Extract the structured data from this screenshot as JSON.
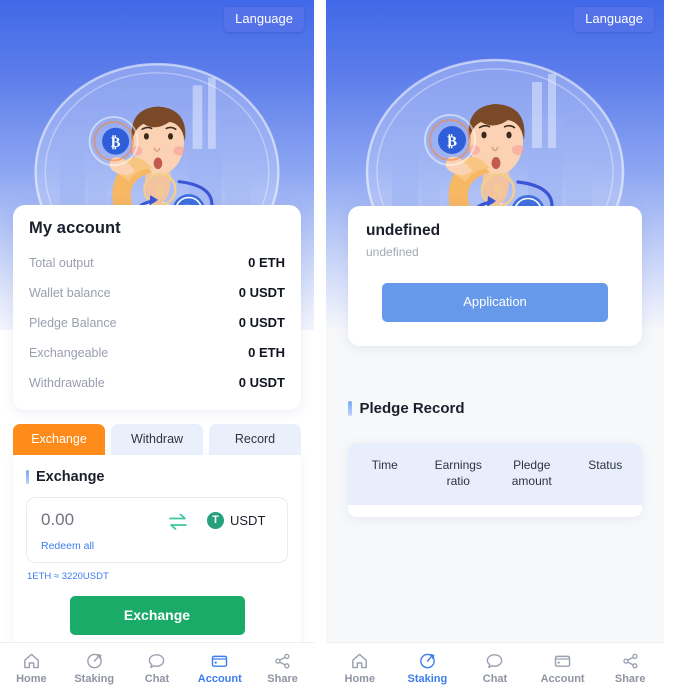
{
  "left": {
    "language_button": "Language",
    "account": {
      "title": "My account",
      "rows": [
        {
          "label": "Total output",
          "value": "0 ETH"
        },
        {
          "label": "Wallet balance",
          "value": "0 USDT"
        },
        {
          "label": "Pledge Balance",
          "value": "0 USDT"
        },
        {
          "label": "Exchangeable",
          "value": "0 ETH"
        },
        {
          "label": "Withdrawable",
          "value": "0 USDT"
        }
      ]
    },
    "tabs": [
      {
        "label": "Exchange",
        "active": true
      },
      {
        "label": "Withdraw",
        "active": false
      },
      {
        "label": "Record",
        "active": false
      }
    ],
    "exchange": {
      "section_title": "Exchange",
      "amount": "0.00",
      "amount_placeholder": "0.00",
      "redeem_all": "Redeem all",
      "swap_icon": "swap-arrows-icon",
      "coin_symbol": "T",
      "coin_label": "USDT",
      "rate": "1ETH ≈ 3220USDT",
      "submit_label": "Exchange"
    },
    "nav": [
      {
        "label": "Home",
        "icon": "home-icon",
        "active": false
      },
      {
        "label": "Staking",
        "icon": "staking-icon",
        "active": false
      },
      {
        "label": "Chat",
        "icon": "chat-icon",
        "active": false
      },
      {
        "label": "Account",
        "icon": "wallet-icon",
        "active": true
      },
      {
        "label": "Share",
        "icon": "share-icon",
        "active": false
      }
    ]
  },
  "right": {
    "language_button": "Language",
    "info_card": {
      "title": "undefined",
      "subtitle": "undefined",
      "button_label": "Application"
    },
    "pledge_record": {
      "title": "Pledge Record",
      "columns": [
        "Time",
        "Earnings ratio",
        "Pledge amount",
        "Status"
      ],
      "rows": []
    },
    "nav": [
      {
        "label": "Home",
        "icon": "home-icon",
        "active": false
      },
      {
        "label": "Staking",
        "icon": "staking-icon",
        "active": true
      },
      {
        "label": "Chat",
        "icon": "chat-icon",
        "active": false
      },
      {
        "label": "Account",
        "icon": "wallet-icon",
        "active": false
      },
      {
        "label": "Share",
        "icon": "share-icon",
        "active": false
      }
    ]
  },
  "colors": {
    "hero_top": "#4169e8",
    "accent_blue": "#3d7df0",
    "tab_active_orange": "#ff8c1a",
    "exchange_green": "#1aab68",
    "application_blue": "#6699ea",
    "usdt_green": "#26a17b",
    "table_header_bg": "#e8eefc"
  }
}
